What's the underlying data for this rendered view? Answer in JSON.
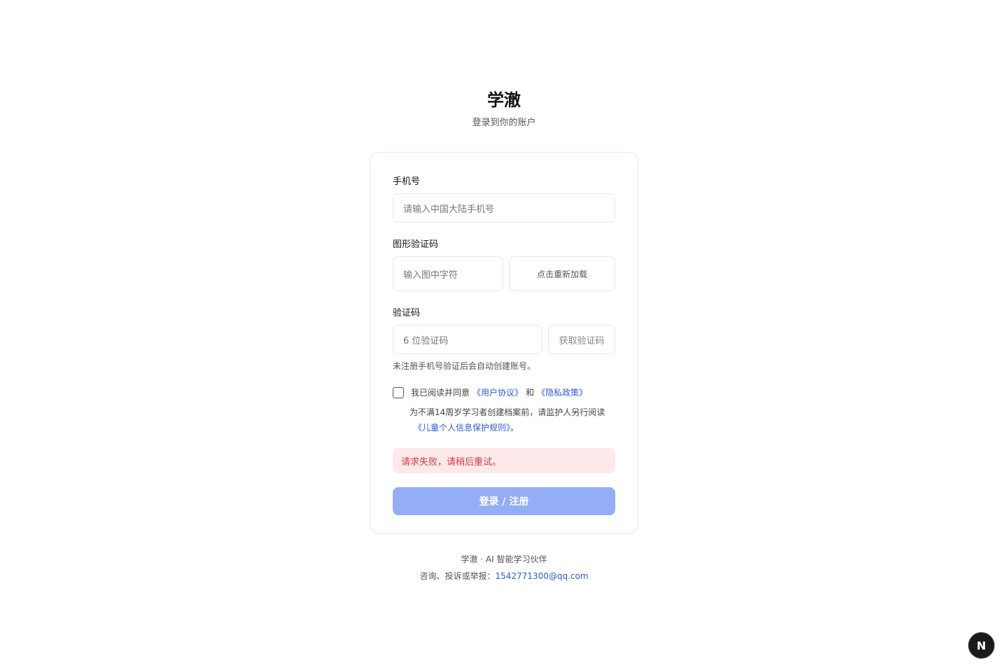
{
  "brand": {
    "title": "学澈",
    "subtitle": "登录到你的账户"
  },
  "form": {
    "phone": {
      "label": "手机号",
      "placeholder": "请输入中国大陆手机号",
      "value": ""
    },
    "captcha": {
      "label": "图形验证码",
      "placeholder": "输入图中字符",
      "value": "",
      "reload_label": "点击重新加载"
    },
    "sms_code": {
      "label": "验证码",
      "placeholder": "6 位验证码",
      "value": "",
      "send_label": "获取验证码"
    },
    "hint": "未注册手机号验证后会自动创建账号。",
    "agreement": {
      "checked": false,
      "prefix": "我已阅读并同意",
      "user_agreement": "《用户协议》",
      "and": "和",
      "privacy_policy": "《隐私政策》"
    },
    "minor_note": {
      "text": "为不满14周岁学习者创建档案前，请监护人另行阅读",
      "link": "《儿童个人信息保护规则》",
      "suffix": "。"
    },
    "error": "请求失败，请稍后重试。",
    "submit_label": "登录 / 注册"
  },
  "footer": {
    "line1": "学澈 · AI 智能学习伙伴",
    "contact_prefix": "咨询、投诉或举报：",
    "email": "1542771300@qq.com"
  },
  "dev_badge": {
    "letter": "N",
    "icon": "nextjs-icon"
  },
  "colors": {
    "accent": "#2d5bd7",
    "submit_disabled": "#93aef4",
    "error_bg": "#fde9ea",
    "error_text": "#d9383e"
  }
}
